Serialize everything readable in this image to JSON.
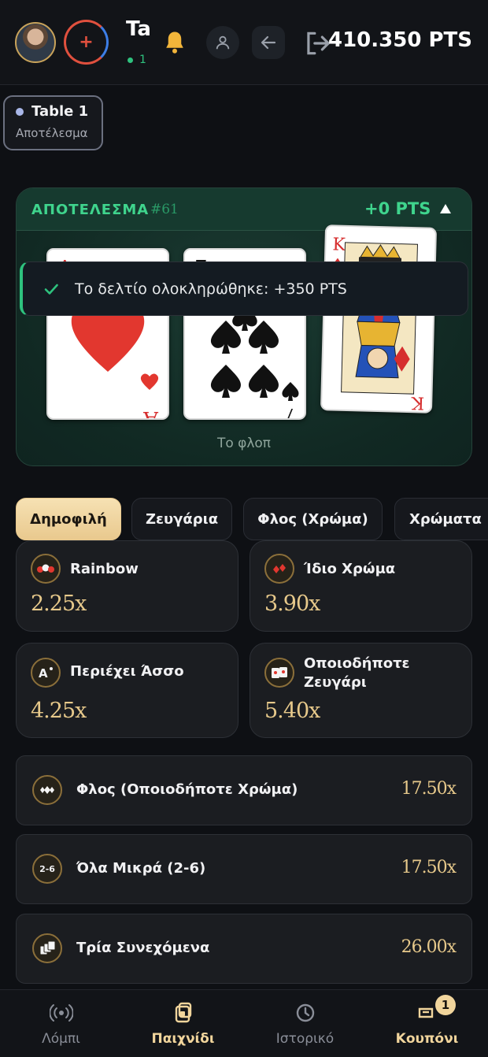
{
  "header": {
    "title": "Ta",
    "status": "1",
    "points": "410.350 PTS"
  },
  "table_chip": {
    "name": "Table 1",
    "status": "Αποτέλεσμα"
  },
  "result": {
    "title": "ΑΠΟΤΕΛΕΣΜΑ",
    "round_id": "#61",
    "points": "+0 PTS",
    "flop_label": "Το φλοπ",
    "cards": [
      {
        "rank": "A",
        "suit": "hearts"
      },
      {
        "rank": "7",
        "suit": "spades"
      },
      {
        "rank": "K",
        "suit": "diamonds"
      }
    ]
  },
  "toast": {
    "message": "Το δελτίο ολοκληρώθηκε: +350 PTS",
    "color": "#2ec27e"
  },
  "tabs": [
    {
      "label": "Δημοφιλή",
      "active": true
    },
    {
      "label": "Ζευγάρια",
      "active": false
    },
    {
      "label": "Φλος (Χρώμα)",
      "active": false
    },
    {
      "label": "Χρώματα",
      "active": false
    }
  ],
  "bets": [
    {
      "name": "Rainbow",
      "odds": "2.25x",
      "icon": "rainbow-suits-icon"
    },
    {
      "name": "Ίδιο Χρώμα",
      "odds": "3.90x",
      "icon": "same-color-icon"
    },
    {
      "name": "Περιέχει Άσσο",
      "odds": "4.25x",
      "icon": "ace-icon"
    },
    {
      "name": "Οποιοδήποτε Ζευγάρι",
      "odds": "5.40x",
      "icon": "pair-icon"
    }
  ],
  "rows": [
    {
      "name": "Φλος (Οποιοδήποτε Χρώμα)",
      "odds": "17.50x",
      "icon": "flush-icon"
    },
    {
      "name": "Όλα Μικρά (2-6)",
      "odds": "17.50x",
      "icon_text": "2-6"
    },
    {
      "name": "Τρία Συνεχόμενα",
      "odds": "26.00x",
      "icon": "straight-icon"
    }
  ],
  "nav": {
    "items": [
      {
        "label": "Λόμπι",
        "icon": "broadcast-icon"
      },
      {
        "label": "Παιχνίδι",
        "icon": "game-icon"
      },
      {
        "label": "Ιστορικό",
        "icon": "history-icon"
      },
      {
        "label": "Κουπόνι",
        "icon": "ticket-icon"
      }
    ],
    "badge": "1"
  },
  "colors": {
    "accent_gold": "#e7c98b",
    "accent_green": "#3fd48d",
    "background": "#0e1014"
  }
}
